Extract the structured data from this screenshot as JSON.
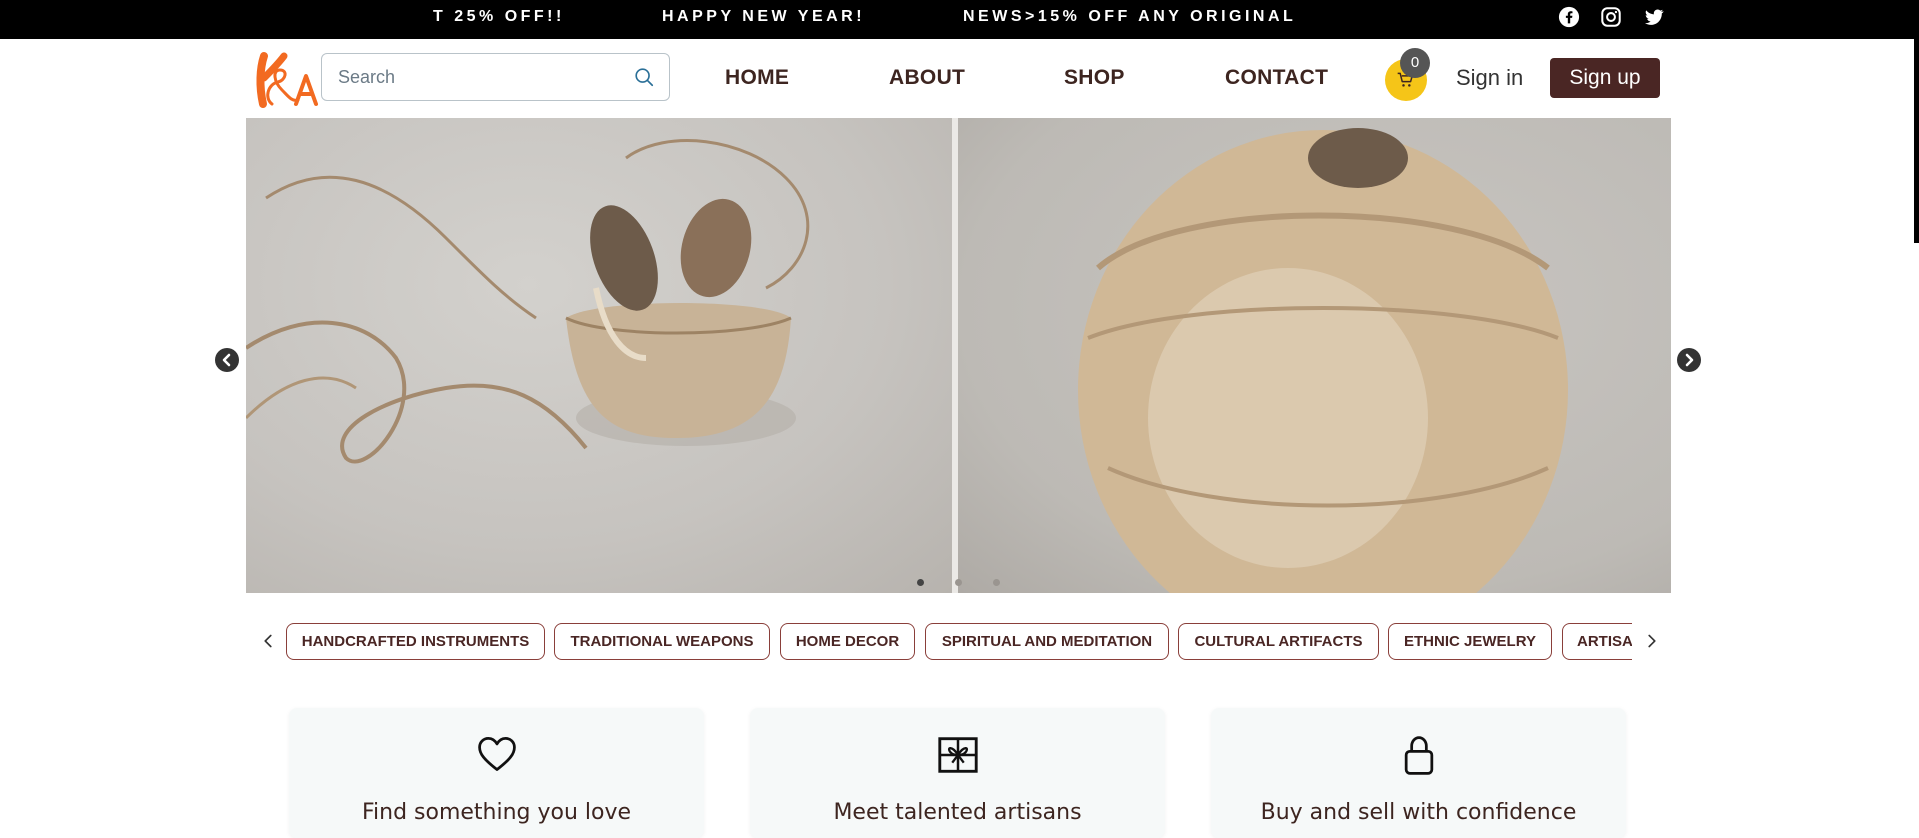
{
  "announcement_bar": {
    "items": [
      "T 25% OFF!!",
      "HAPPY NEW YEAR!",
      "NEWS>15% OFF ANY ORIGINAL"
    ]
  },
  "social": {
    "icons": [
      "facebook-icon",
      "instagram-icon",
      "twitter-icon"
    ]
  },
  "header": {
    "logo_text": "K&A",
    "search": {
      "placeholder": "Search",
      "value": ""
    },
    "nav": [
      "HOME",
      "ABOUT",
      "SHOP",
      "CONTACT"
    ],
    "cart_count": "0",
    "sign_in_label": "Sign in",
    "sign_up_label": "Sign up"
  },
  "carousel": {
    "slides_count": 3,
    "active_slide": 1
  },
  "categories": [
    "HANDCRAFTED INSTRUMENTS",
    "TRADITIONAL WEAPONS",
    "HOME DECOR",
    "SPIRITUAL AND MEDITATION",
    "CULTURAL ARTIFACTS",
    "ETHNIC JEWELRY",
    "ARTISA"
  ],
  "features": [
    {
      "icon": "heart-icon",
      "title": "Find something you love"
    },
    {
      "icon": "gift-icon",
      "title": "Meet talented artisans"
    },
    {
      "icon": "lock-icon",
      "title": "Buy and sell with confidence"
    }
  ],
  "colors": {
    "brand_dark": "#4a2624",
    "logo_orange": "#f26a21",
    "cart_yellow": "#f5c518",
    "topbar": "#000000"
  }
}
